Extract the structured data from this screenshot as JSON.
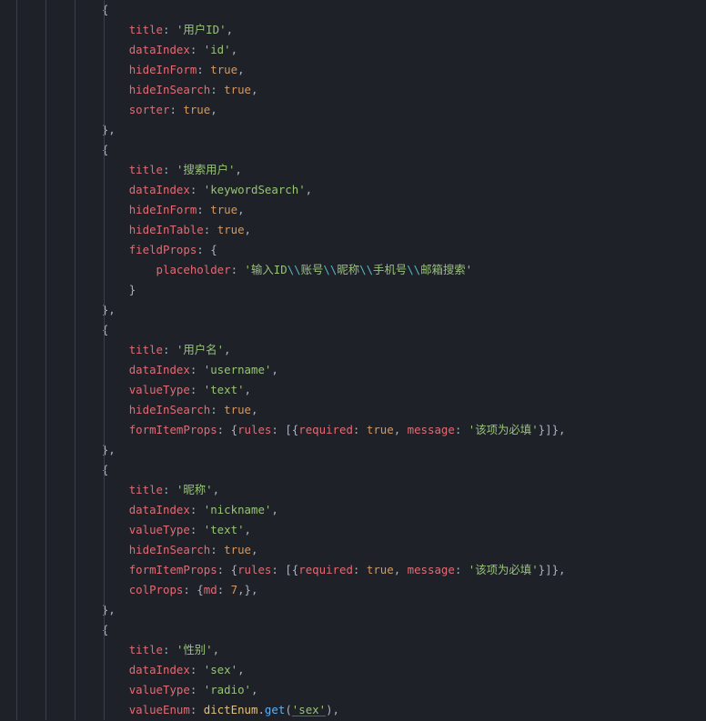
{
  "language": "javascript",
  "theme": "one-dark",
  "visible_lines": 36,
  "tokens": [
    [
      [
        "    ",
        "punc"
      ],
      [
        "{",
        "punc"
      ]
    ],
    [
      [
        "        ",
        "punc"
      ],
      [
        "title",
        "key"
      ],
      [
        ":",
        "punc"
      ],
      [
        " ",
        "punc"
      ],
      [
        "'用户ID'",
        "str"
      ],
      [
        ",",
        "punc"
      ]
    ],
    [
      [
        "        ",
        "punc"
      ],
      [
        "dataIndex",
        "key"
      ],
      [
        ":",
        "punc"
      ],
      [
        " ",
        "punc"
      ],
      [
        "'id'",
        "str"
      ],
      [
        ",",
        "punc"
      ]
    ],
    [
      [
        "        ",
        "punc"
      ],
      [
        "hideInForm",
        "key"
      ],
      [
        ":",
        "punc"
      ],
      [
        " ",
        "punc"
      ],
      [
        "true",
        "bool"
      ],
      [
        ",",
        "punc"
      ]
    ],
    [
      [
        "        ",
        "punc"
      ],
      [
        "hideInSearch",
        "key"
      ],
      [
        ":",
        "punc"
      ],
      [
        " ",
        "punc"
      ],
      [
        "true",
        "bool"
      ],
      [
        ",",
        "punc"
      ]
    ],
    [
      [
        "        ",
        "punc"
      ],
      [
        "sorter",
        "key"
      ],
      [
        ":",
        "punc"
      ],
      [
        " ",
        "punc"
      ],
      [
        "true",
        "bool"
      ],
      [
        ",",
        "punc"
      ]
    ],
    [
      [
        "    ",
        "punc"
      ],
      [
        "},",
        "punc"
      ]
    ],
    [
      [
        "    ",
        "punc"
      ],
      [
        "{",
        "punc"
      ]
    ],
    [
      [
        "        ",
        "punc"
      ],
      [
        "title",
        "key"
      ],
      [
        ":",
        "punc"
      ],
      [
        " ",
        "punc"
      ],
      [
        "'搜索用户'",
        "str"
      ],
      [
        ",",
        "punc"
      ]
    ],
    [
      [
        "        ",
        "punc"
      ],
      [
        "dataIndex",
        "key"
      ],
      [
        ":",
        "punc"
      ],
      [
        " ",
        "punc"
      ],
      [
        "'keywordSearch'",
        "str"
      ],
      [
        ",",
        "punc"
      ]
    ],
    [
      [
        "        ",
        "punc"
      ],
      [
        "hideInForm",
        "key"
      ],
      [
        ":",
        "punc"
      ],
      [
        " ",
        "punc"
      ],
      [
        "true",
        "bool"
      ],
      [
        ",",
        "punc"
      ]
    ],
    [
      [
        "        ",
        "punc"
      ],
      [
        "hideInTable",
        "key"
      ],
      [
        ":",
        "punc"
      ],
      [
        " ",
        "punc"
      ],
      [
        "true",
        "bool"
      ],
      [
        ",",
        "punc"
      ]
    ],
    [
      [
        "        ",
        "punc"
      ],
      [
        "fieldProps",
        "key"
      ],
      [
        ":",
        "punc"
      ],
      [
        " {",
        "punc"
      ]
    ],
    [
      [
        "            ",
        "punc"
      ],
      [
        "placeholder",
        "key"
      ],
      [
        ":",
        "punc"
      ],
      [
        " ",
        "punc"
      ],
      [
        "'输入ID",
        "str"
      ],
      [
        "\\\\",
        "esc"
      ],
      [
        "账号",
        "str"
      ],
      [
        "\\\\",
        "esc"
      ],
      [
        "昵称",
        "str"
      ],
      [
        "\\\\",
        "esc"
      ],
      [
        "手机号",
        "str"
      ],
      [
        "\\\\",
        "esc"
      ],
      [
        "邮箱搜索'",
        "str"
      ]
    ],
    [
      [
        "        ",
        "punc"
      ],
      [
        "}",
        "punc"
      ]
    ],
    [
      [
        "    ",
        "punc"
      ],
      [
        "},",
        "punc"
      ]
    ],
    [
      [
        "    ",
        "punc"
      ],
      [
        "{",
        "punc"
      ]
    ],
    [
      [
        "        ",
        "punc"
      ],
      [
        "title",
        "key"
      ],
      [
        ":",
        "punc"
      ],
      [
        " ",
        "punc"
      ],
      [
        "'用户名'",
        "str"
      ],
      [
        ",",
        "punc"
      ]
    ],
    [
      [
        "        ",
        "punc"
      ],
      [
        "dataIndex",
        "key"
      ],
      [
        ":",
        "punc"
      ],
      [
        " ",
        "punc"
      ],
      [
        "'username'",
        "str"
      ],
      [
        ",",
        "punc"
      ]
    ],
    [
      [
        "        ",
        "punc"
      ],
      [
        "valueType",
        "key"
      ],
      [
        ":",
        "punc"
      ],
      [
        " ",
        "punc"
      ],
      [
        "'text'",
        "str"
      ],
      [
        ",",
        "punc"
      ]
    ],
    [
      [
        "        ",
        "punc"
      ],
      [
        "hideInSearch",
        "key"
      ],
      [
        ":",
        "punc"
      ],
      [
        " ",
        "punc"
      ],
      [
        "true",
        "bool"
      ],
      [
        ",",
        "punc"
      ]
    ],
    [
      [
        "        ",
        "punc"
      ],
      [
        "formItemProps",
        "key"
      ],
      [
        ":",
        "punc"
      ],
      [
        " {",
        "punc"
      ],
      [
        "rules",
        "key"
      ],
      [
        ":",
        "punc"
      ],
      [
        " [{",
        "punc"
      ],
      [
        "required",
        "key"
      ],
      [
        ":",
        "punc"
      ],
      [
        " ",
        "punc"
      ],
      [
        "true",
        "bool"
      ],
      [
        ", ",
        "punc"
      ],
      [
        "message",
        "key"
      ],
      [
        ":",
        "punc"
      ],
      [
        " ",
        "punc"
      ],
      [
        "'该项为必填'",
        "str"
      ],
      [
        "}]},",
        "punc"
      ]
    ],
    [
      [
        "    ",
        "punc"
      ],
      [
        "},",
        "punc"
      ]
    ],
    [
      [
        "    ",
        "punc"
      ],
      [
        "{",
        "punc"
      ]
    ],
    [
      [
        "        ",
        "punc"
      ],
      [
        "title",
        "key"
      ],
      [
        ":",
        "punc"
      ],
      [
        " ",
        "punc"
      ],
      [
        "'昵称'",
        "str"
      ],
      [
        ",",
        "punc"
      ]
    ],
    [
      [
        "        ",
        "punc"
      ],
      [
        "dataIndex",
        "key"
      ],
      [
        ":",
        "punc"
      ],
      [
        " ",
        "punc"
      ],
      [
        "'nickname'",
        "str"
      ],
      [
        ",",
        "punc"
      ]
    ],
    [
      [
        "        ",
        "punc"
      ],
      [
        "valueType",
        "key"
      ],
      [
        ":",
        "punc"
      ],
      [
        " ",
        "punc"
      ],
      [
        "'text'",
        "str"
      ],
      [
        ",",
        "punc"
      ]
    ],
    [
      [
        "        ",
        "punc"
      ],
      [
        "hideInSearch",
        "key"
      ],
      [
        ":",
        "punc"
      ],
      [
        " ",
        "punc"
      ],
      [
        "true",
        "bool"
      ],
      [
        ",",
        "punc"
      ]
    ],
    [
      [
        "        ",
        "punc"
      ],
      [
        "formItemProps",
        "key"
      ],
      [
        ":",
        "punc"
      ],
      [
        " {",
        "punc"
      ],
      [
        "rules",
        "key"
      ],
      [
        ":",
        "punc"
      ],
      [
        " [{",
        "punc"
      ],
      [
        "required",
        "key"
      ],
      [
        ":",
        "punc"
      ],
      [
        " ",
        "punc"
      ],
      [
        "true",
        "bool"
      ],
      [
        ", ",
        "punc"
      ],
      [
        "message",
        "key"
      ],
      [
        ":",
        "punc"
      ],
      [
        " ",
        "punc"
      ],
      [
        "'该项为必填'",
        "str"
      ],
      [
        "}]},",
        "punc"
      ]
    ],
    [
      [
        "        ",
        "punc"
      ],
      [
        "colProps",
        "key"
      ],
      [
        ":",
        "punc"
      ],
      [
        " {",
        "punc"
      ],
      [
        "md",
        "key"
      ],
      [
        ":",
        "punc"
      ],
      [
        " ",
        "punc"
      ],
      [
        "7",
        "num"
      ],
      [
        ",},",
        "punc"
      ]
    ],
    [
      [
        "    ",
        "punc"
      ],
      [
        "},",
        "punc"
      ]
    ],
    [
      [
        "    ",
        "punc"
      ],
      [
        "{",
        "punc"
      ]
    ],
    [
      [
        "        ",
        "punc"
      ],
      [
        "title",
        "key"
      ],
      [
        ":",
        "punc"
      ],
      [
        " ",
        "punc"
      ],
      [
        "'性别'",
        "str"
      ],
      [
        ",",
        "punc"
      ]
    ],
    [
      [
        "        ",
        "punc"
      ],
      [
        "dataIndex",
        "key"
      ],
      [
        ":",
        "punc"
      ],
      [
        " ",
        "punc"
      ],
      [
        "'sex'",
        "str"
      ],
      [
        ",",
        "punc"
      ]
    ],
    [
      [
        "        ",
        "punc"
      ],
      [
        "valueType",
        "key"
      ],
      [
        ":",
        "punc"
      ],
      [
        " ",
        "punc"
      ],
      [
        "'radio'",
        "str"
      ],
      [
        ",",
        "punc"
      ]
    ],
    [
      [
        "        ",
        "punc"
      ],
      [
        "valueEnum",
        "key"
      ],
      [
        ":",
        "punc"
      ],
      [
        " ",
        "punc"
      ],
      [
        "dictEnum",
        "ident"
      ],
      [
        ".",
        "punc"
      ],
      [
        "get",
        "call"
      ],
      [
        "(",
        "punc"
      ],
      [
        "'sex'",
        "str-u"
      ],
      [
        "),",
        "punc"
      ]
    ]
  ]
}
